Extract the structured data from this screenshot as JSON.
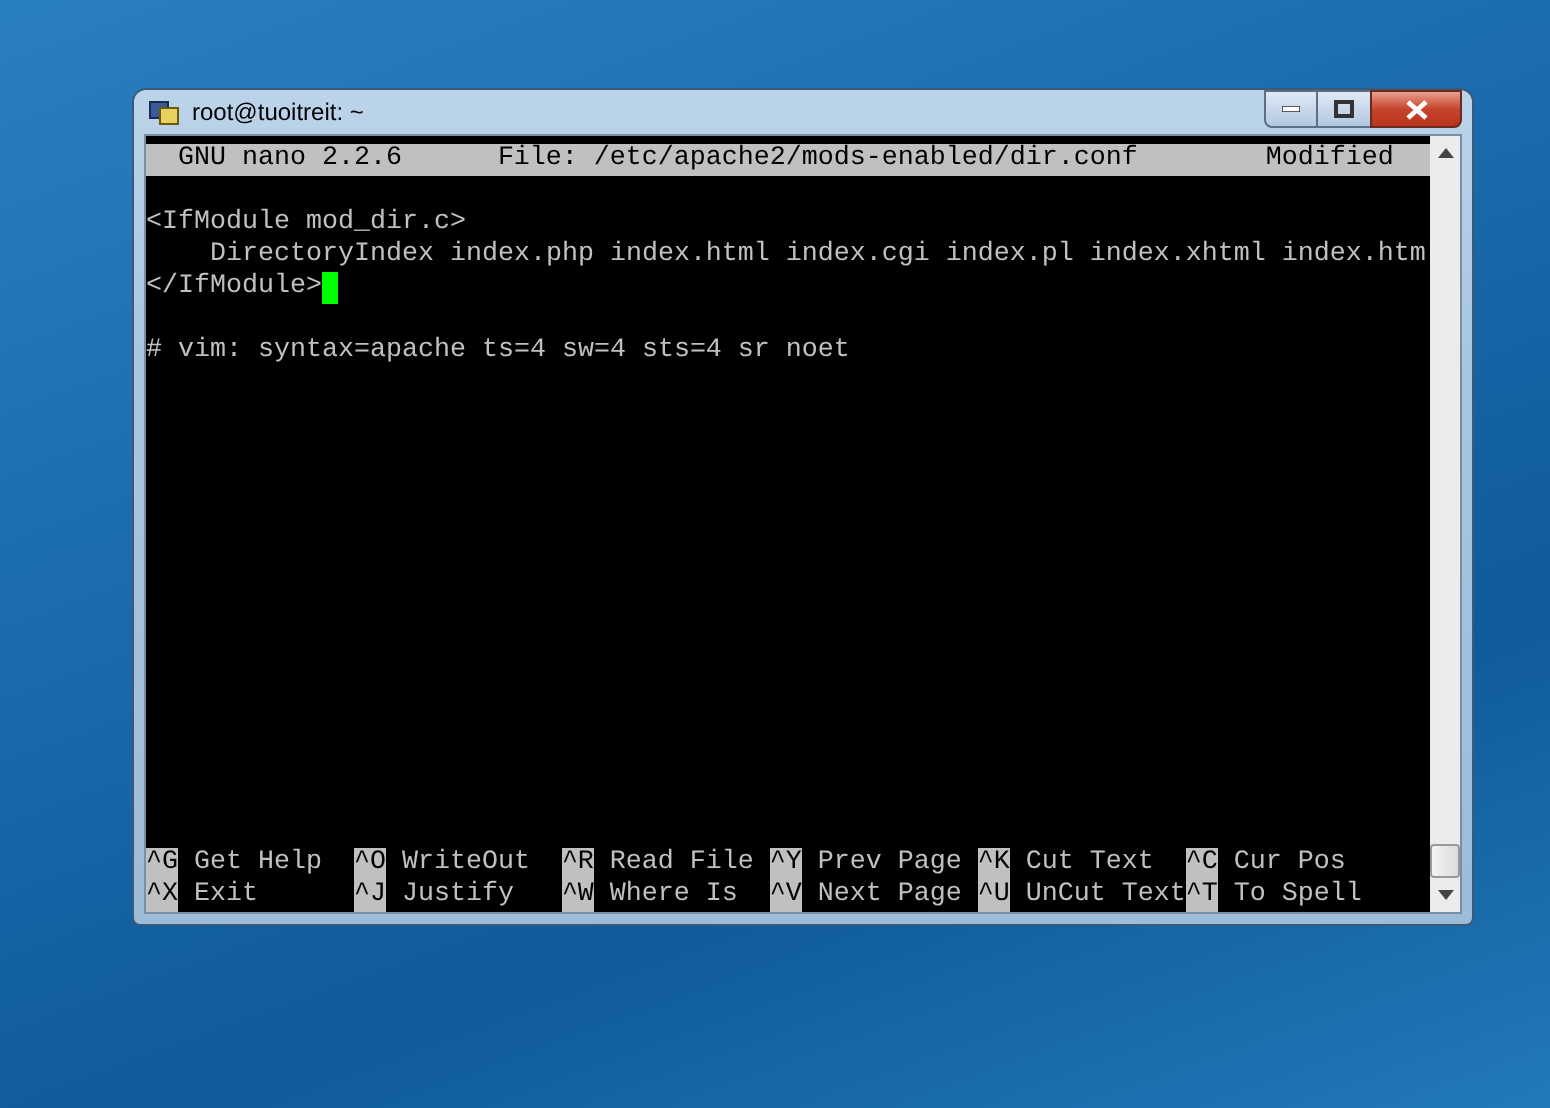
{
  "window": {
    "title": "root@tuoitreit: ~"
  },
  "nano": {
    "header": {
      "version": "GNU nano 2.2.6",
      "file": "File: /etc/apache2/mods-enabled/dir.conf",
      "status": "Modified"
    },
    "lines": [
      {
        "cursor": false
      },
      {
        "text": "<IfModule mod_dir.c>",
        "cursor": false
      },
      {
        "text": "    DirectoryIndex index.php index.html index.cgi index.pl index.xhtml index.htm",
        "cursor": false
      },
      {
        "text": "</IfModule>",
        "cursor": true
      },
      {
        "cursor": false
      },
      {
        "text": "# vim: syntax=apache ts=4 sw=4 sts=4 sr noet",
        "cursor": false
      }
    ],
    "shortcut_rows": [
      [
        {
          "key": "^G",
          "label": "Get Help"
        },
        {
          "key": "^O",
          "label": "WriteOut"
        },
        {
          "key": "^R",
          "label": "Read File"
        },
        {
          "key": "^Y",
          "label": "Prev Page"
        },
        {
          "key": "^K",
          "label": "Cut Text"
        },
        {
          "key": "^C",
          "label": "Cur Pos"
        }
      ],
      [
        {
          "key": "^X",
          "label": "Exit"
        },
        {
          "key": "^J",
          "label": "Justify"
        },
        {
          "key": "^W",
          "label": "Where Is"
        },
        {
          "key": "^V",
          "label": "Next Page"
        },
        {
          "key": "^U",
          "label": "UnCut Text"
        },
        {
          "key": "^T",
          "label": "To Spell"
        }
      ]
    ]
  }
}
